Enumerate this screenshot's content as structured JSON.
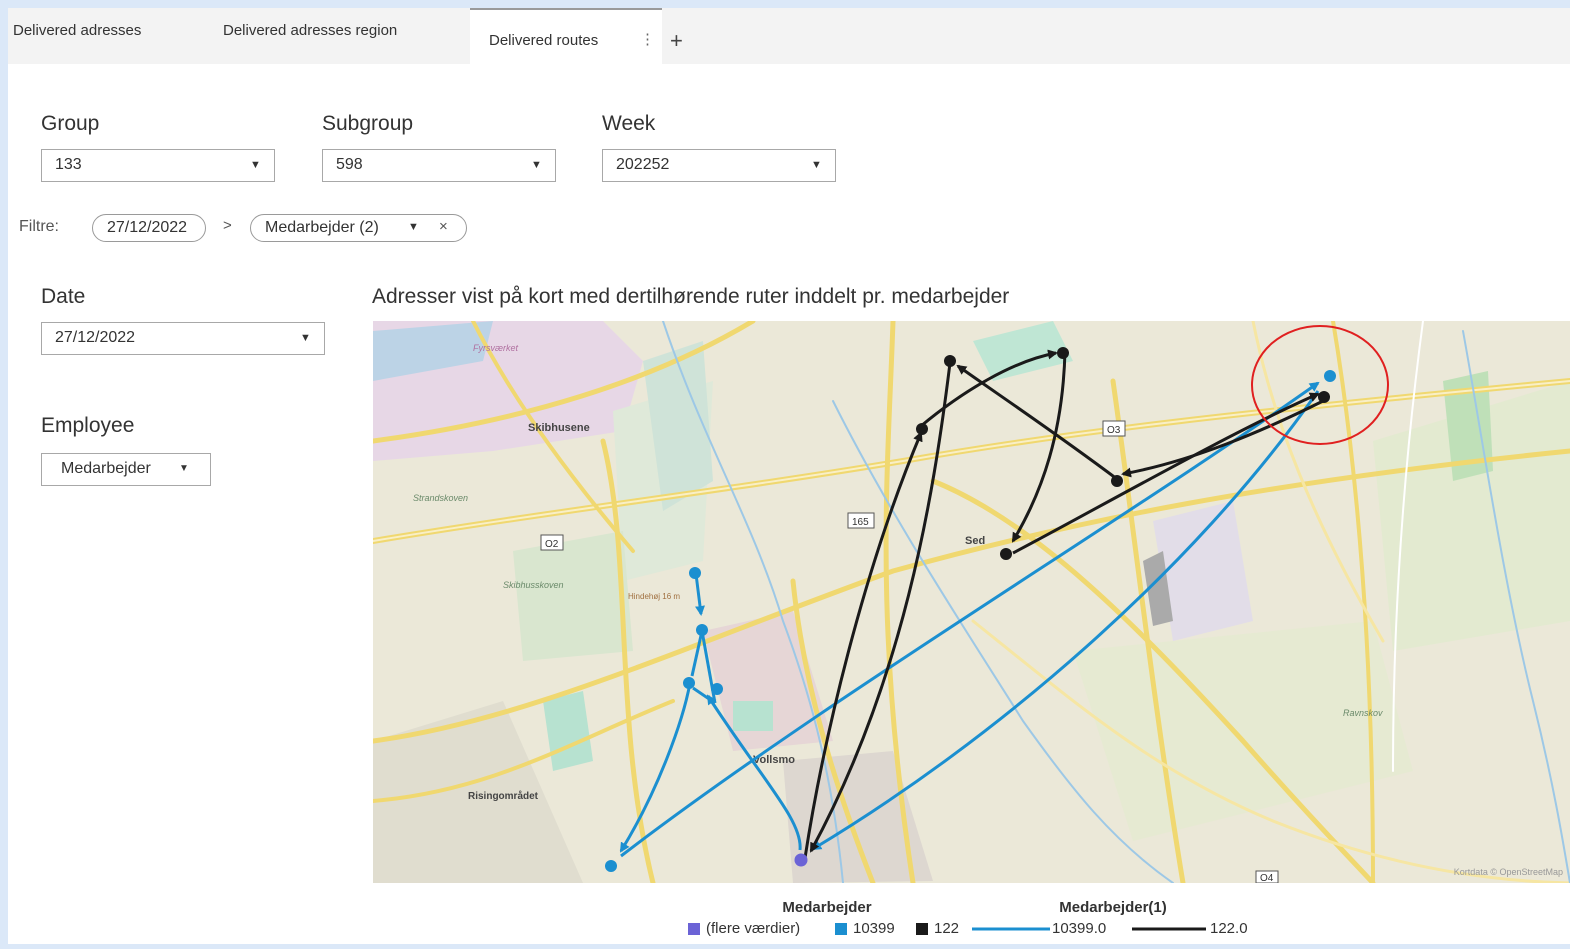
{
  "tabs": [
    {
      "label": "Delivered adresses"
    },
    {
      "label": "Delivered adresses region"
    },
    {
      "label": "Delivered routes"
    }
  ],
  "icons": {
    "tab_menu": "vertical-dots-icon",
    "add_tab": "plus-icon",
    "dropdown": "caret-down-icon",
    "remove": "close-icon",
    "breadcrumb": "chevron-right-icon"
  },
  "filters": {
    "group": {
      "label": "Group",
      "value": "133"
    },
    "subgroup": {
      "label": "Subgroup",
      "value": "598"
    },
    "week": {
      "label": "Week",
      "value": "202252"
    },
    "date": {
      "label": "Date",
      "value": "27/12/2022"
    },
    "employee": {
      "label": "Employee",
      "value": "Medarbejder"
    }
  },
  "filter_bar": {
    "label": "Filtre:",
    "chips": [
      "27/12/2022",
      "Medarbejder (2)"
    ],
    "separator": ">",
    "remove": "×"
  },
  "map": {
    "title": "Adresser vist på kort med dertilhørende ruter inddelt pr. medarbejder",
    "place_labels": [
      "Skibhusene",
      "Sed",
      "Vollsmo",
      "Risingområdet",
      "Skibhusskoven",
      "Strandskoven",
      "Fyrsværket",
      "Hindehøj 16 m",
      "Ravnskov"
    ],
    "road_labels": [
      "O2",
      "O3",
      "165",
      "O4"
    ],
    "attribution": "Kortdata © OpenStreetMap",
    "highlight_color": "#e02020"
  },
  "legend": {
    "marker_title": "Medarbejder",
    "marker_items": [
      {
        "label": "(flere værdier)",
        "color": "#6b63d6"
      },
      {
        "label": "10399",
        "color": "#1b8fd0"
      },
      {
        "label": "122",
        "color": "#1a1a1a"
      }
    ],
    "line_title": "Medarbejder(1)",
    "line_items": [
      {
        "label": "10399.0",
        "color": "#1b8fd0"
      },
      {
        "label": "122.0",
        "color": "#1a1a1a"
      }
    ]
  },
  "colors": {
    "route_blue": "#1b8fd0",
    "route_black": "#1a1a1a",
    "start_point": "#6b63d6"
  }
}
